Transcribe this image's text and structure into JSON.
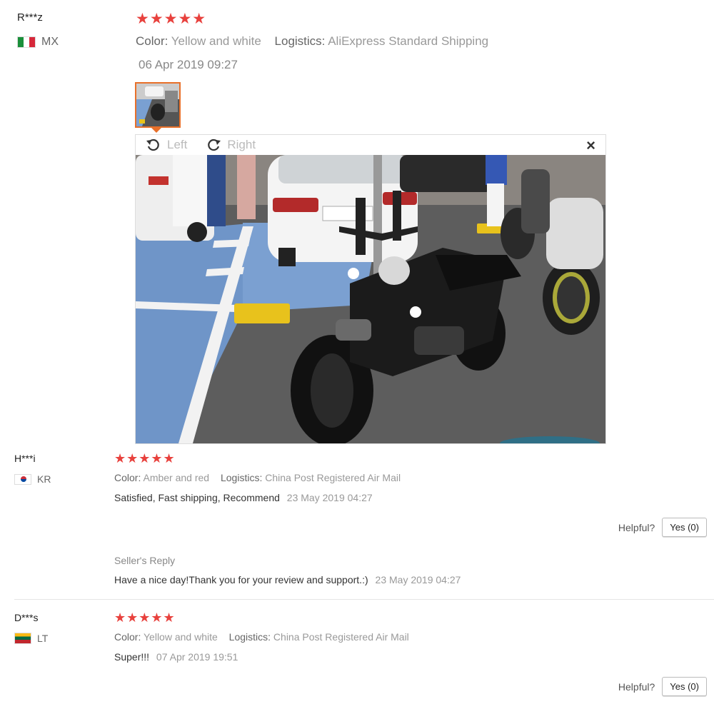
{
  "reviews": [
    {
      "user": "R***z",
      "country_code": "MX",
      "stars": "★★★★★",
      "color_label": "Color:",
      "color_value": "Yellow and white",
      "logistics_label": "Logistics:",
      "logistics_value": "AliExpress Standard Shipping",
      "date": "06 Apr 2019 09:27"
    },
    {
      "user": "H***i",
      "country_code": "KR",
      "stars": "★★★★★",
      "color_label": "Color:",
      "color_value": "Amber and red",
      "logistics_label": "Logistics:",
      "logistics_value": "China Post Registered Air Mail",
      "text": "Satisfied, Fast shipping, Recommend",
      "date": "23 May 2019 04:27",
      "helpful_label": "Helpful?",
      "yes_label": "Yes (0)",
      "seller_reply_label": "Seller's Reply",
      "seller_reply_text": "Have a nice day!Thank you for your review and support.:)",
      "seller_reply_date": "23 May 2019 04:27"
    },
    {
      "user": "D***s",
      "country_code": "LT",
      "stars": "★★★★★",
      "color_label": "Color:",
      "color_value": "Yellow and white",
      "logistics_label": "Logistics:",
      "logistics_value": "China Post Registered Air Mail",
      "text": "Super!!!",
      "date": "07 Apr 2019 19:51",
      "helpful_label": "Helpful?",
      "yes_label": "Yes (0)"
    }
  ],
  "viewer": {
    "rotate_left_label": "Left",
    "rotate_right_label": "Right",
    "close_glyph": "×",
    "rotate_left_icon": "rotate-left-icon",
    "rotate_right_icon": "rotate-right-icon"
  },
  "colors": {
    "star": "#e8413d",
    "thumb_border": "#e8702a",
    "ground_blue": "#6f95c8",
    "asphalt": "#5f5f5f"
  }
}
